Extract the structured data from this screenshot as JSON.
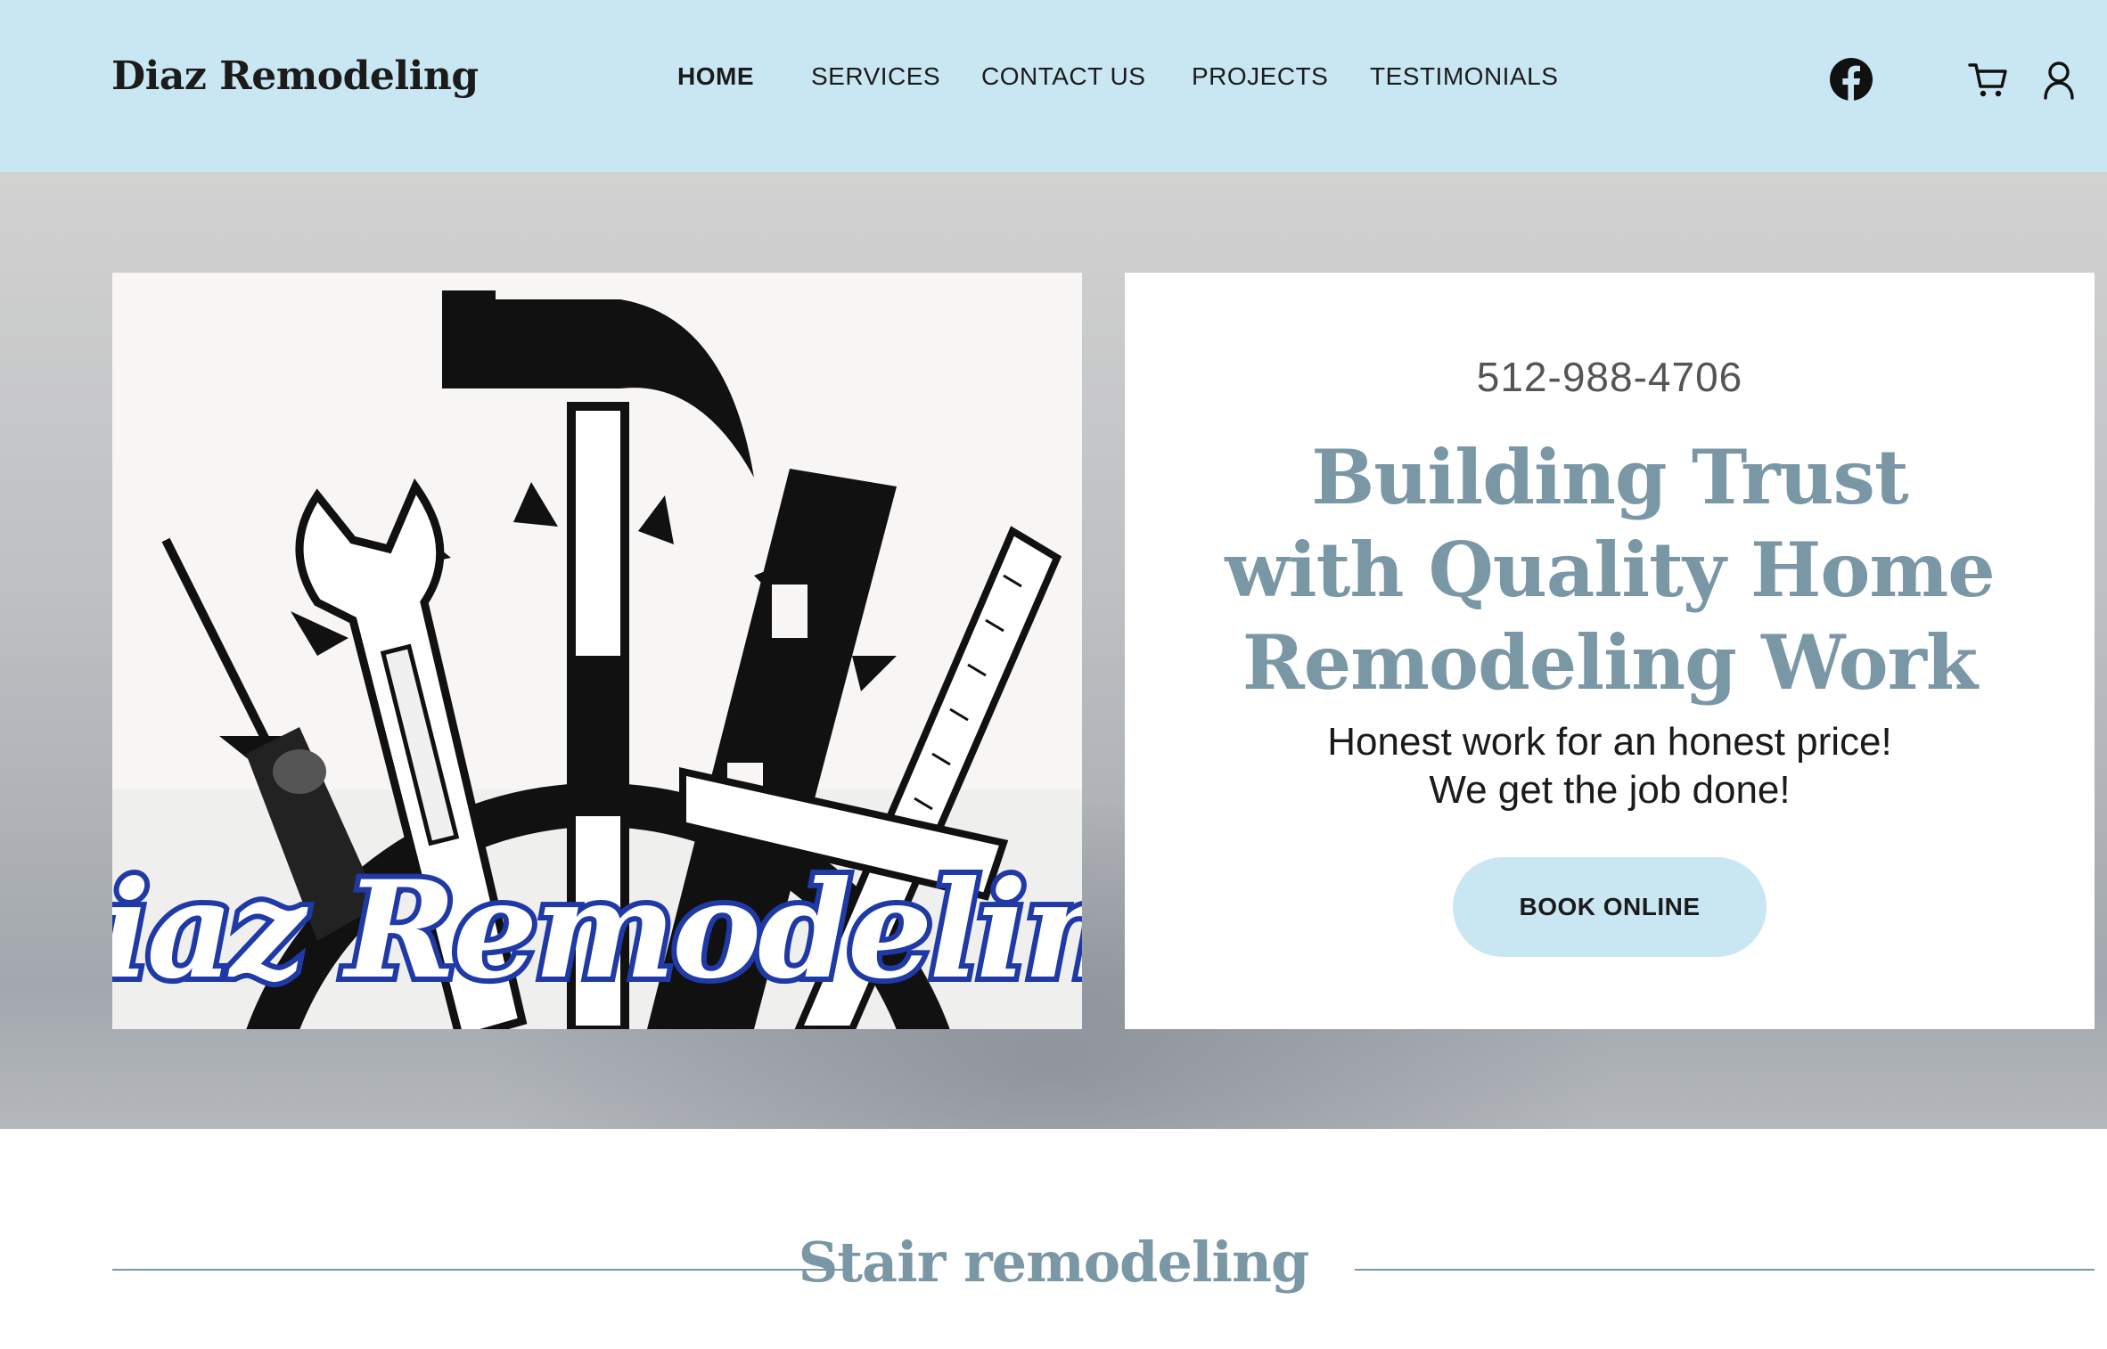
{
  "header": {
    "brand": "Diaz Remodeling",
    "nav": [
      {
        "label": "HOME",
        "active": true
      },
      {
        "label": "SERVICES",
        "active": false
      },
      {
        "label": "CONTACT US",
        "active": false
      },
      {
        "label": "PROJECTS",
        "active": false
      },
      {
        "label": "TESTIMONIALS",
        "active": false
      }
    ],
    "icons": [
      "facebook-icon",
      "cart-icon",
      "account-icon"
    ]
  },
  "hero": {
    "image_logo_text": "Diaz Remodeling",
    "phone": "512-988-4706",
    "headline": "Building Trust with Quality Home Remodeling Work",
    "tagline_line1": "Honest work for an honest price!",
    "tagline_line2": "We get the job done!",
    "cta_label": "BOOK ONLINE"
  },
  "section": {
    "title": "Stair remodeling"
  },
  "colors": {
    "header_bg": "#c9e7f3",
    "accent_slate": "#7a97a5",
    "cta_bg": "#c9e7f3",
    "logo_blue": "#1f3aa6",
    "text_dark": "#1b1b1b"
  }
}
